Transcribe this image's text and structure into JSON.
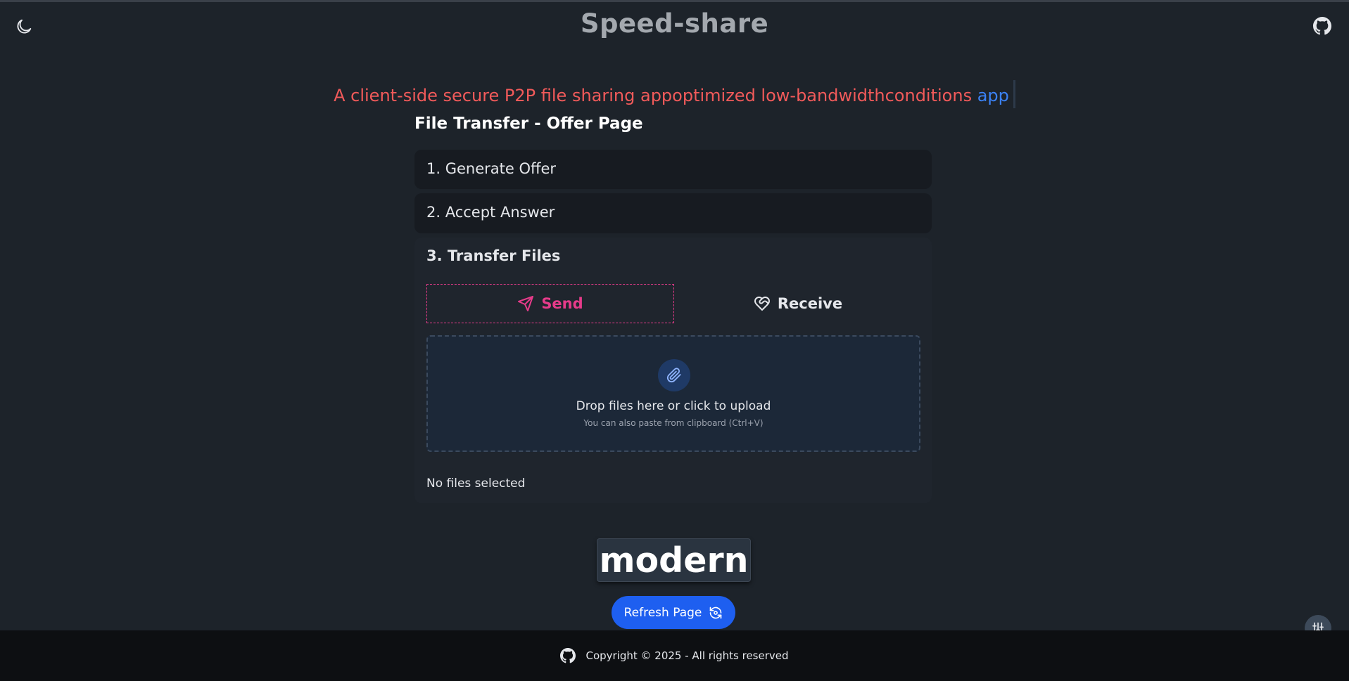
{
  "header": {
    "title": "Speed-share",
    "icons": {
      "theme": "moon-icon",
      "repo": "github-icon"
    }
  },
  "tagline": {
    "main": "A client-side secure P2P file sharing appoptimized low-bandwidthconditions ",
    "accent": "app"
  },
  "panel": {
    "title": "File Transfer - Offer Page",
    "steps": [
      {
        "label": "1. Generate Offer"
      },
      {
        "label": "2. Accept Answer"
      },
      {
        "label": "3. Transfer Files"
      }
    ],
    "tabs": {
      "send": {
        "label": "Send",
        "icon": "paper-plane-icon",
        "color": "#e63b8a"
      },
      "receive": {
        "label": "Receive",
        "icon": "heart-handshake-icon"
      }
    },
    "dropzone": {
      "icon": "paperclip-icon",
      "main": "Drop files here or click to upload",
      "sub": "You can also paste from clipboard (Ctrl+V)"
    },
    "status": "No files selected"
  },
  "badge": {
    "text": "modern"
  },
  "refresh": {
    "label": "Refresh Page",
    "icon": "refresh-icon",
    "color": "#1e5ff0"
  },
  "settings": {
    "icon": "sliders-icon"
  },
  "footer": {
    "text": "Copyright © 2025 - All rights reserved",
    "icon": "github-icon"
  }
}
